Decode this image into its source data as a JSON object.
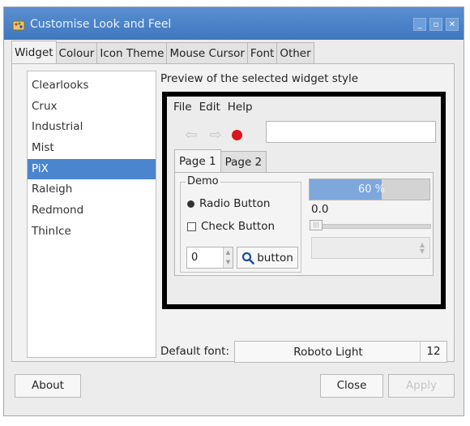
{
  "window": {
    "title": "Customise Look and Feel",
    "controls": [
      "_",
      "▫",
      "✕"
    ]
  },
  "tabs": [
    {
      "label": "Widget",
      "active": true
    },
    {
      "label": "Colour",
      "active": false
    },
    {
      "label": "Icon Theme",
      "active": false
    },
    {
      "label": "Mouse Cursor",
      "active": false
    },
    {
      "label": "Font",
      "active": false
    },
    {
      "label": "Other",
      "active": false
    }
  ],
  "themes": {
    "items": [
      "Clearlooks",
      "Crux",
      "Industrial",
      "Mist",
      "PiX",
      "Raleigh",
      "Redmond",
      "ThinIce"
    ],
    "selected": "PiX"
  },
  "preview": {
    "caption": "Preview of the selected widget style",
    "menu": [
      "File",
      "Edit",
      "Help"
    ],
    "tabs": [
      {
        "label": "Page 1",
        "active": true
      },
      {
        "label": "Page 2",
        "active": false
      }
    ],
    "demo_label": "Demo",
    "radio_label": "Radio Button",
    "check_label": "Check Button",
    "spin_value": "0",
    "button_label": "button",
    "progress_text": "60 %",
    "progress_value": 0.6,
    "scale_value": "0.0",
    "colors": {
      "record": "#d9161d",
      "progress_fill": "#7ea8dc"
    }
  },
  "font": {
    "label": "Default font:",
    "name": "Roboto Light",
    "size": "12"
  },
  "buttons": {
    "about": "About",
    "close": "Close",
    "apply": "Apply"
  },
  "colors": {
    "titlebar": "#4a85cd",
    "selection": "#4a85cd"
  }
}
